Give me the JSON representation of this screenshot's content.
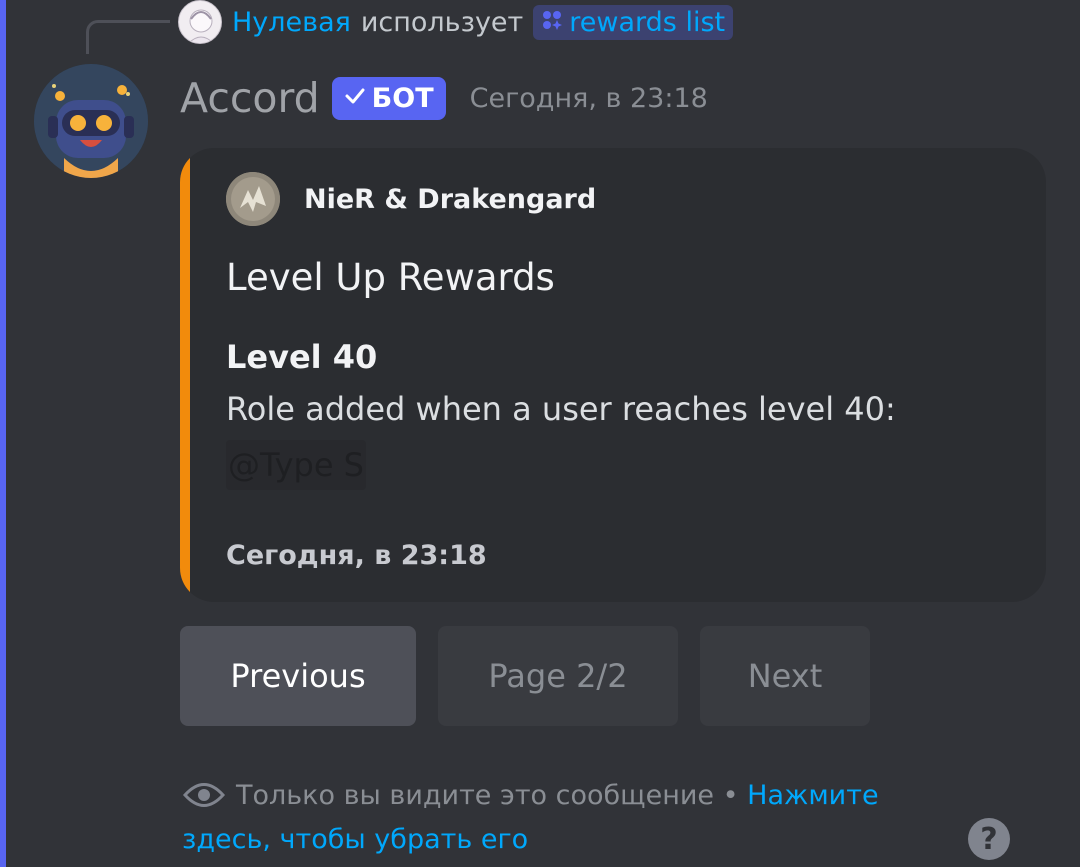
{
  "colors": {
    "background": "#313338",
    "embed_accent": "#f28b0c",
    "bot_badge": "#5865f2",
    "link": "#00a8fc"
  },
  "reply": {
    "user": "Нулевая",
    "action": "использует",
    "command_icon": "command-icon",
    "command": "rewards list"
  },
  "message": {
    "author": "Accord",
    "badge": "БОТ",
    "timestamp": "Сегодня, в 23:18"
  },
  "embed": {
    "author": "NieR & Drakengard",
    "title": "Level Up Rewards",
    "field_name": "Level 40",
    "field_value": "Role  added when a user reaches level 40:",
    "role_mention": "@Type S",
    "footer": "Сегодня, в 23:18"
  },
  "buttons": {
    "previous": "Previous",
    "page": "Page 2/2",
    "next": "Next"
  },
  "ephemeral": {
    "notice": "Только вы видите это сообщение • ",
    "link": "Нажмите здесь, чтобы убрать его"
  },
  "help": {
    "label": "?"
  }
}
